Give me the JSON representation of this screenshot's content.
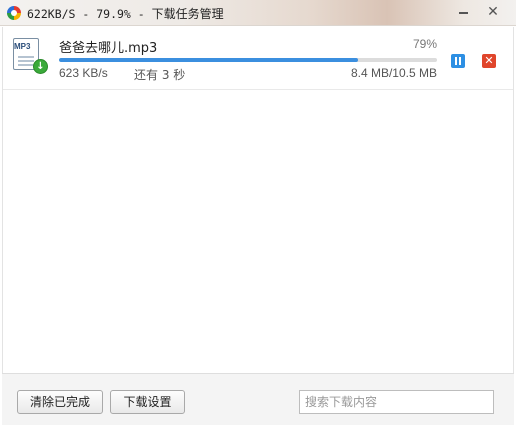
{
  "window": {
    "title_prefix": "622KB/S - 79.9% - ",
    "title_suffix": "下载任务管理",
    "minimize_icon": "minimize-icon",
    "close_glyph": "✕"
  },
  "task": {
    "file_name": "爸爸去哪儿.mp3",
    "file_type": "MP3",
    "percent": "79%",
    "progress_fraction": 0.79,
    "speed": "623 KB/s",
    "remaining": "还有 3 秒",
    "size": "8.4 MB/10.5 MB",
    "icons": {
      "file": "mp3-file-icon",
      "badge": "download-arrow-icon",
      "pause": "pause-icon",
      "cancel": "close-icon"
    },
    "cancel_glyph": "✕",
    "badge_glyph": "↓"
  },
  "footer": {
    "clear_label": "清除已完成",
    "settings_label": "下载设置",
    "search_placeholder": "搜索下载内容"
  },
  "colors": {
    "progress": "#3b8fdf",
    "pause": "#2d8fe3",
    "cancel": "#e0452b",
    "badge": "#3aaa3a"
  }
}
